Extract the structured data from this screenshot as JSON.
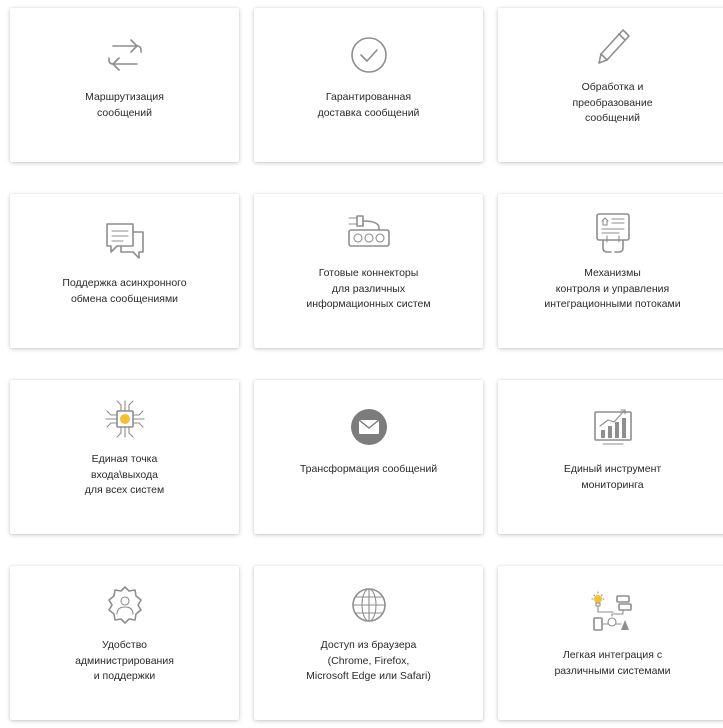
{
  "features": [
    {
      "icon": "routing-arrows-icon",
      "label": "Маршрутизация\nсообщений"
    },
    {
      "icon": "checkmark-circle-icon",
      "label": "Гарантированная\nдоставка сообщений"
    },
    {
      "icon": "pencil-icon",
      "label": "Обработка и\nпреобразование\nсообщений"
    },
    {
      "icon": "chat-bubbles-icon",
      "label": "Поддержка асинхронного\nобмена сообщениями"
    },
    {
      "icon": "connector-plug-icon",
      "label": "Готовые коннекторы\nдля различных\nинформационных систем"
    },
    {
      "icon": "touch-control-panel-icon",
      "label": "Механизмы\nконтроля и управления\nинтеграционными потоками"
    },
    {
      "icon": "chip-hub-icon",
      "label": "Единая точка\nвхода\\выхода\nдля всех систем"
    },
    {
      "icon": "envelope-circle-icon",
      "label": "Трансформация сообщений"
    },
    {
      "icon": "monitoring-chart-icon",
      "label": "Единый инструмент\nмониторинга"
    },
    {
      "icon": "admin-gear-user-icon",
      "label": "Удобство\nадминистрирования\nи поддержки"
    },
    {
      "icon": "globe-icon",
      "label": "Доступ из браузера\n(Chrome, Firefox,\nMicrosoft Edge или Safari)"
    },
    {
      "icon": "integration-systems-icon",
      "label": "Легкая интеграция с\nразличными системами"
    }
  ],
  "colors": {
    "icon_gray": "#8e8e8e",
    "text": "#2a2a2a",
    "accent_yellow": "#f2c230",
    "card_background": "#ffffff"
  }
}
